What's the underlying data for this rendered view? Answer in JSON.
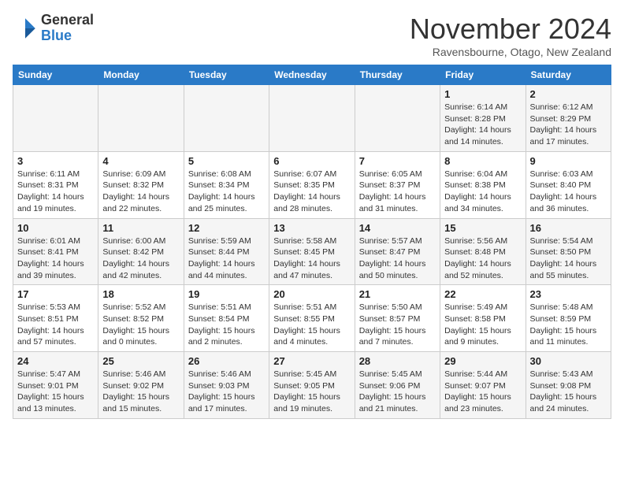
{
  "logo": {
    "general": "General",
    "blue": "Blue"
  },
  "title": "November 2024",
  "subtitle": "Ravensbourne, Otago, New Zealand",
  "days_of_week": [
    "Sunday",
    "Monday",
    "Tuesday",
    "Wednesday",
    "Thursday",
    "Friday",
    "Saturday"
  ],
  "weeks": [
    [
      {
        "day": "",
        "info": ""
      },
      {
        "day": "",
        "info": ""
      },
      {
        "day": "",
        "info": ""
      },
      {
        "day": "",
        "info": ""
      },
      {
        "day": "",
        "info": ""
      },
      {
        "day": "1",
        "info": "Sunrise: 6:14 AM\nSunset: 8:28 PM\nDaylight: 14 hours and 14 minutes."
      },
      {
        "day": "2",
        "info": "Sunrise: 6:12 AM\nSunset: 8:29 PM\nDaylight: 14 hours and 17 minutes."
      }
    ],
    [
      {
        "day": "3",
        "info": "Sunrise: 6:11 AM\nSunset: 8:31 PM\nDaylight: 14 hours and 19 minutes."
      },
      {
        "day": "4",
        "info": "Sunrise: 6:09 AM\nSunset: 8:32 PM\nDaylight: 14 hours and 22 minutes."
      },
      {
        "day": "5",
        "info": "Sunrise: 6:08 AM\nSunset: 8:34 PM\nDaylight: 14 hours and 25 minutes."
      },
      {
        "day": "6",
        "info": "Sunrise: 6:07 AM\nSunset: 8:35 PM\nDaylight: 14 hours and 28 minutes."
      },
      {
        "day": "7",
        "info": "Sunrise: 6:05 AM\nSunset: 8:37 PM\nDaylight: 14 hours and 31 minutes."
      },
      {
        "day": "8",
        "info": "Sunrise: 6:04 AM\nSunset: 8:38 PM\nDaylight: 14 hours and 34 minutes."
      },
      {
        "day": "9",
        "info": "Sunrise: 6:03 AM\nSunset: 8:40 PM\nDaylight: 14 hours and 36 minutes."
      }
    ],
    [
      {
        "day": "10",
        "info": "Sunrise: 6:01 AM\nSunset: 8:41 PM\nDaylight: 14 hours and 39 minutes."
      },
      {
        "day": "11",
        "info": "Sunrise: 6:00 AM\nSunset: 8:42 PM\nDaylight: 14 hours and 42 minutes."
      },
      {
        "day": "12",
        "info": "Sunrise: 5:59 AM\nSunset: 8:44 PM\nDaylight: 14 hours and 44 minutes."
      },
      {
        "day": "13",
        "info": "Sunrise: 5:58 AM\nSunset: 8:45 PM\nDaylight: 14 hours and 47 minutes."
      },
      {
        "day": "14",
        "info": "Sunrise: 5:57 AM\nSunset: 8:47 PM\nDaylight: 14 hours and 50 minutes."
      },
      {
        "day": "15",
        "info": "Sunrise: 5:56 AM\nSunset: 8:48 PM\nDaylight: 14 hours and 52 minutes."
      },
      {
        "day": "16",
        "info": "Sunrise: 5:54 AM\nSunset: 8:50 PM\nDaylight: 14 hours and 55 minutes."
      }
    ],
    [
      {
        "day": "17",
        "info": "Sunrise: 5:53 AM\nSunset: 8:51 PM\nDaylight: 14 hours and 57 minutes."
      },
      {
        "day": "18",
        "info": "Sunrise: 5:52 AM\nSunset: 8:52 PM\nDaylight: 15 hours and 0 minutes."
      },
      {
        "day": "19",
        "info": "Sunrise: 5:51 AM\nSunset: 8:54 PM\nDaylight: 15 hours and 2 minutes."
      },
      {
        "day": "20",
        "info": "Sunrise: 5:51 AM\nSunset: 8:55 PM\nDaylight: 15 hours and 4 minutes."
      },
      {
        "day": "21",
        "info": "Sunrise: 5:50 AM\nSunset: 8:57 PM\nDaylight: 15 hours and 7 minutes."
      },
      {
        "day": "22",
        "info": "Sunrise: 5:49 AM\nSunset: 8:58 PM\nDaylight: 15 hours and 9 minutes."
      },
      {
        "day": "23",
        "info": "Sunrise: 5:48 AM\nSunset: 8:59 PM\nDaylight: 15 hours and 11 minutes."
      }
    ],
    [
      {
        "day": "24",
        "info": "Sunrise: 5:47 AM\nSunset: 9:01 PM\nDaylight: 15 hours and 13 minutes."
      },
      {
        "day": "25",
        "info": "Sunrise: 5:46 AM\nSunset: 9:02 PM\nDaylight: 15 hours and 15 minutes."
      },
      {
        "day": "26",
        "info": "Sunrise: 5:46 AM\nSunset: 9:03 PM\nDaylight: 15 hours and 17 minutes."
      },
      {
        "day": "27",
        "info": "Sunrise: 5:45 AM\nSunset: 9:05 PM\nDaylight: 15 hours and 19 minutes."
      },
      {
        "day": "28",
        "info": "Sunrise: 5:45 AM\nSunset: 9:06 PM\nDaylight: 15 hours and 21 minutes."
      },
      {
        "day": "29",
        "info": "Sunrise: 5:44 AM\nSunset: 9:07 PM\nDaylight: 15 hours and 23 minutes."
      },
      {
        "day": "30",
        "info": "Sunrise: 5:43 AM\nSunset: 9:08 PM\nDaylight: 15 hours and 24 minutes."
      }
    ]
  ]
}
